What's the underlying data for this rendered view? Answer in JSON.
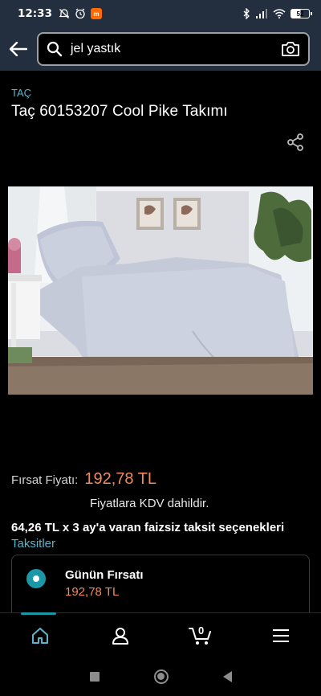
{
  "status_bar": {
    "time": "12:33",
    "battery": "52",
    "icons": [
      "alarm-off-icon",
      "alarm-icon",
      "mi-app-icon",
      "bluetooth-icon",
      "signal-icon",
      "wifi-icon",
      "battery-icon"
    ]
  },
  "search": {
    "query": "jel yastık",
    "icons": [
      "back-arrow-icon",
      "search-icon",
      "camera-icon"
    ]
  },
  "product": {
    "brand": "TAÇ",
    "title": "Taç 60153207 Cool Pike Takımı"
  },
  "pricing": {
    "deal_label": "Fırsat Fiyatı:",
    "deal_price": "192,78 TL",
    "vat_note": "Fiyatlara KDV dahildir.",
    "installments_text": "64,26 TL x 3 ay'a varan faizsiz taksit seçenekleri",
    "installments_link": "Taksitler"
  },
  "offer": {
    "title": "Günün Fırsatı",
    "price": "192,78 TL"
  },
  "bottom_nav": {
    "items": [
      "home-icon",
      "account-icon",
      "cart-icon",
      "menu-icon"
    ],
    "cart_count": "0"
  },
  "colors": {
    "header_bg": "#232f3e",
    "link": "#5bb4c9",
    "price": "#f08a5d",
    "accent": "#1a98a6"
  }
}
